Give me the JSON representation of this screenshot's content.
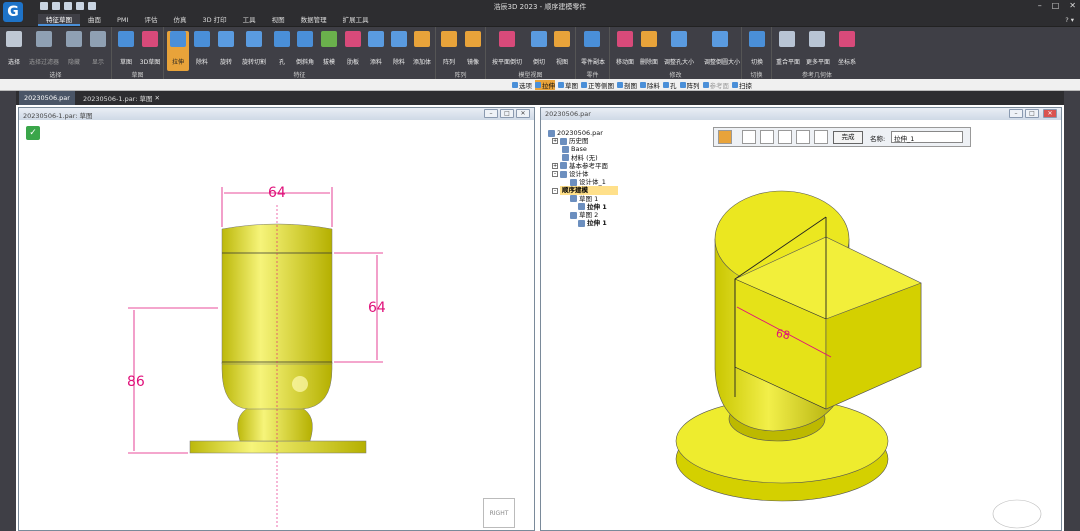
{
  "app": {
    "title": "浩辰3D 2023 - 顺序建模零件"
  },
  "tabs": [
    "特征草图",
    "曲面",
    "PMI",
    "评估",
    "仿真",
    "3D 打印",
    "工具",
    "视图",
    "数据管理",
    "扩展工具"
  ],
  "ribbon": {
    "groups": [
      {
        "label": "选择",
        "buttons": [
          "选择",
          "选择过滤器",
          "隐藏",
          "显示"
        ]
      },
      {
        "label": "草图",
        "buttons": [
          "草图",
          "3D草图"
        ]
      },
      {
        "label": "特征",
        "buttons": [
          "拉伸",
          "除料",
          "旋转",
          "旋转切割",
          "孔",
          "倒斜角",
          "拔模",
          "肋板",
          "添料",
          "除料",
          "添加体"
        ]
      },
      {
        "label": "阵列",
        "buttons": [
          "阵列",
          "镜像"
        ]
      },
      {
        "label": "模型视图",
        "buttons": [
          "按平面倒切",
          "倒切",
          "视图"
        ]
      },
      {
        "label": "零件",
        "buttons": [
          "零件副本"
        ]
      },
      {
        "label": "修改",
        "buttons": [
          "移动面",
          "删除面",
          "调整孔大小",
          "调整倒圆大小"
        ]
      },
      {
        "label": "切换",
        "buttons": [
          "切换"
        ]
      },
      {
        "label": "参考几何体",
        "buttons": [
          "重合平面",
          "更多平面",
          "坐标系"
        ]
      }
    ]
  },
  "cmdbar": [
    "选项",
    "拉伸",
    "草图",
    "正等侧图",
    "剖图",
    "除料",
    "孔",
    "阵列",
    "参考面",
    "扫掠"
  ],
  "doc_tabs": [
    "20230506.par",
    "20230506-1.par: 草图"
  ],
  "left_window": {
    "title": "20230506-1.par: 草图",
    "dims": {
      "top": "64",
      "right": "64",
      "left": "86"
    },
    "view_label": "RIGHT"
  },
  "right_window": {
    "title": "20230506.par",
    "dim": "68"
  },
  "tree": [
    {
      "label": "20230506.par",
      "level": 0
    },
    {
      "label": "历史图",
      "level": 1
    },
    {
      "label": "Base",
      "level": 1
    },
    {
      "label": "材料 (无)",
      "level": 1
    },
    {
      "label": "基本参考平面",
      "level": 1
    },
    {
      "label": "设计体",
      "level": 1
    },
    {
      "label": "设计体_1",
      "level": 2
    },
    {
      "label": "顺序建模",
      "level": 1,
      "highlight": true
    },
    {
      "label": "草图 1",
      "level": 2
    },
    {
      "label": "拉伸 1",
      "level": 3
    },
    {
      "label": "草图 2",
      "level": 2
    },
    {
      "label": "拉伸 1",
      "level": 3
    }
  ],
  "propbar": {
    "done": "完成",
    "name_label": "名称:",
    "name_value": "拉伸_1"
  },
  "colors": {
    "part": "#e3e01a",
    "dim": "#e0107a",
    "ribbon": "#3f3f46",
    "accent": "#e8a33a"
  }
}
